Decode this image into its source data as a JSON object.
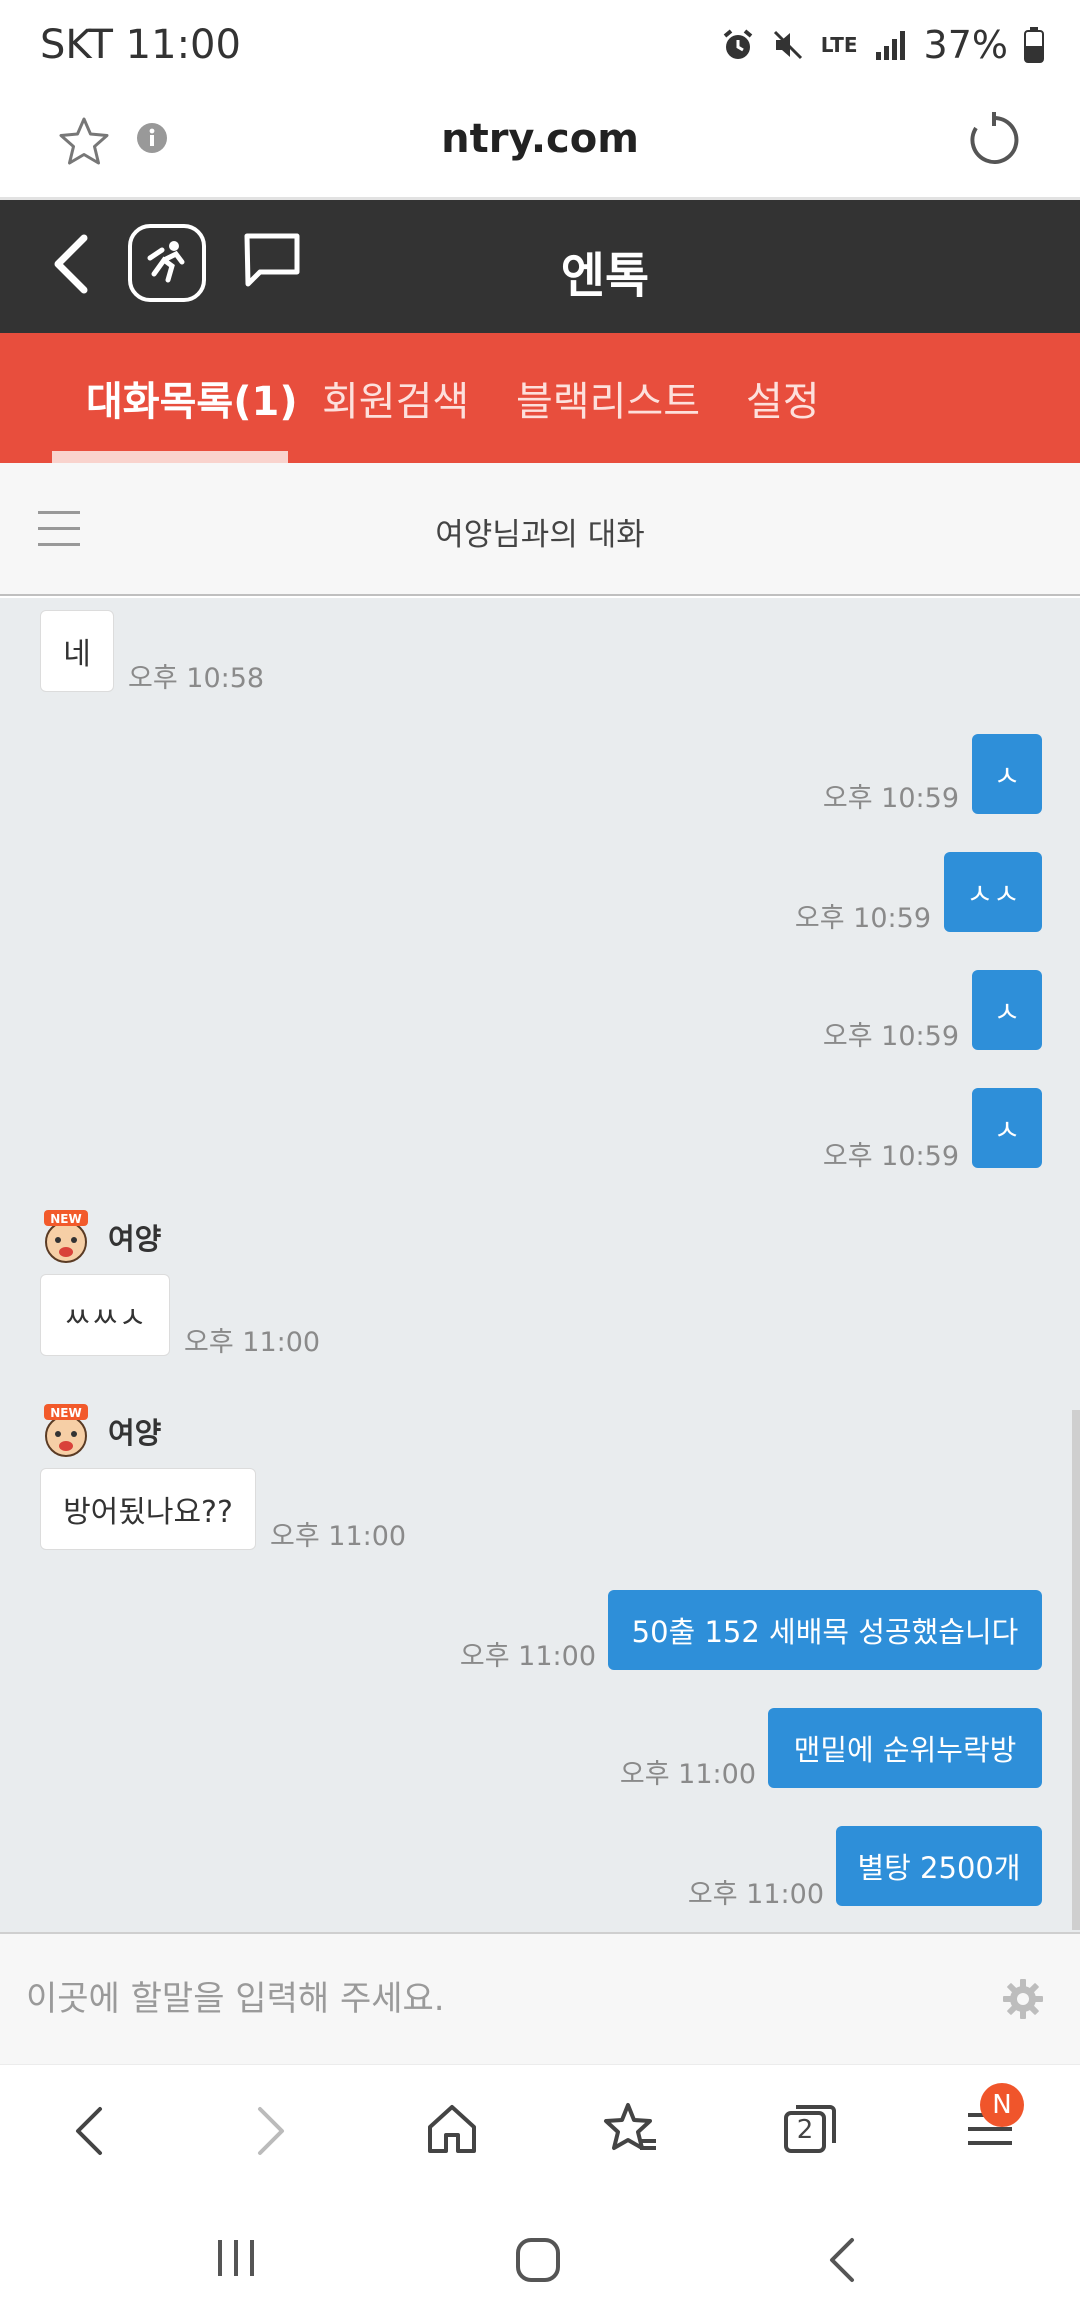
{
  "status_bar": {
    "carrier_time": "SKT 11:00",
    "battery": "37%",
    "network": "LTE"
  },
  "browser": {
    "url": "ntry.com",
    "tab_count": "2",
    "menu_badge": "N"
  },
  "app": {
    "title": "엔톡"
  },
  "tabs": [
    {
      "label": "대화목록(1)",
      "active": true
    },
    {
      "label": "회원검색",
      "active": false
    },
    {
      "label": "블랙리스트",
      "active": false
    },
    {
      "label": "설정",
      "active": false
    }
  ],
  "conversation": {
    "title": "여양님과의 대화"
  },
  "messages": [
    {
      "dir": "in",
      "sender": "",
      "text": "네",
      "time": "오후 10:58"
    },
    {
      "dir": "out",
      "text": "ㅅ",
      "time": "오후 10:59"
    },
    {
      "dir": "out",
      "text": "ㅅㅅ",
      "time": "오후 10:59"
    },
    {
      "dir": "out",
      "text": "ㅅ",
      "time": "오후 10:59"
    },
    {
      "dir": "out",
      "text": "ㅅ",
      "time": "오후 10:59"
    },
    {
      "dir": "in",
      "sender": "여양",
      "avatar_label": "NEW",
      "text": "ㅆㅆㅅ",
      "time": "오후 11:00"
    },
    {
      "dir": "in",
      "sender": "여양",
      "avatar_label": "NEW",
      "text": "방어됬나요??",
      "time": "오후 11:00"
    },
    {
      "dir": "out",
      "text": "50출 152 세배목 성공했습니다",
      "time": "오후 11:00"
    },
    {
      "dir": "out",
      "text": "맨밑에 순위누락방",
      "time": "오후 11:00"
    },
    {
      "dir": "out",
      "text": "별탕 2500개",
      "time": "오후 11:00"
    }
  ],
  "input": {
    "placeholder": "이곳에 할말을 입력해 주세요."
  },
  "colors": {
    "header": "#333333",
    "tabbar": "#e84e3d",
    "out_bubble": "#2e8fd9",
    "chat_bg": "#e9ecee",
    "badge": "#f0552b"
  }
}
